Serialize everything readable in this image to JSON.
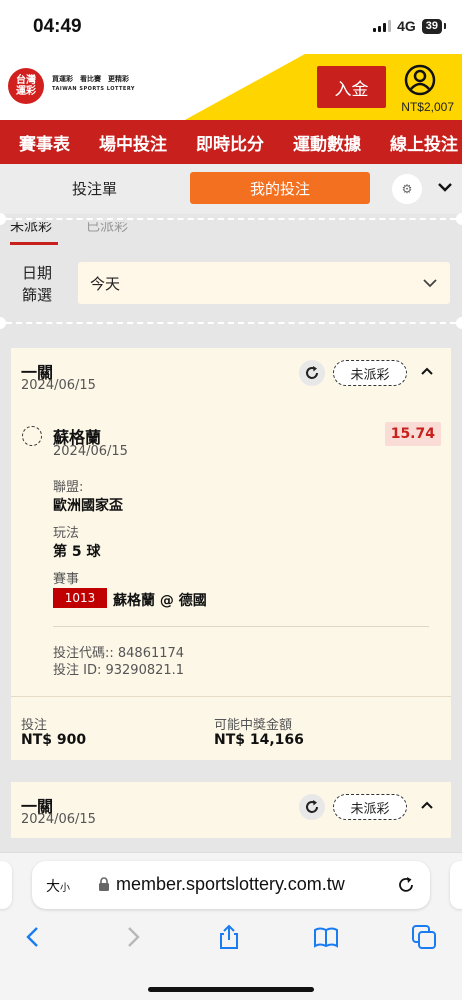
{
  "status_bar": {
    "time": "04:49",
    "network": "4G",
    "battery": "39"
  },
  "header": {
    "logo_line1": "台灣",
    "logo_line2": "運彩",
    "slogan": "買運彩　看比賽　更精彩",
    "brand_en": "TAIWAN SPORTS LOTTERY",
    "deposit_label": "入金",
    "balance": "NT$2,007",
    "brand_red": "#c8201c",
    "brand_yellow": "#ffd500"
  },
  "nav": {
    "items": [
      "賽事表",
      "場中投注",
      "即時比分",
      "運動數據",
      "線上投注"
    ]
  },
  "tabs": {
    "bet_slip": "投注單",
    "my_bets": "我的投注",
    "my_bets_color": "#f37021"
  },
  "filter": {
    "tab_active": "未派彩",
    "tab_inactive": "已派彩",
    "date_label_line1": "日期",
    "date_label_line2": "篩選",
    "date_value": "今天"
  },
  "bets": [
    {
      "type": "一關",
      "date": "2024/06/15",
      "status": "未派彩",
      "selection": "蘇格蘭",
      "selection_date": "2024/06/15",
      "odds": "15.74",
      "league_label": "聯盟:",
      "league": "歐洲國家盃",
      "market_label": "玩法",
      "market": "第 5 球",
      "event_label": "賽事",
      "event_code": "1013",
      "event_name": "蘇格蘭 @ 德國",
      "bet_code": "投注代碼:: 84861174",
      "bet_id": "投注 ID: 93290821.1",
      "stake_label": "投注",
      "stake": "NT$ 900",
      "payout_label": "可能中獎金額",
      "payout": "NT$ 14,166"
    },
    {
      "type": "一關",
      "date": "2024/06/15",
      "status": "未派彩"
    }
  ],
  "browser": {
    "text_size": "大",
    "text_size_small": "小",
    "url": "member.sportslottery.com.tw"
  },
  "icons": [
    "user-icon",
    "gear-icon",
    "chevron-down-icon",
    "refresh-icon",
    "chevron-up-icon",
    "lock-icon",
    "reload-icon",
    "back-icon",
    "forward-icon",
    "share-icon",
    "bookmarks-icon",
    "tabs-icon"
  ]
}
